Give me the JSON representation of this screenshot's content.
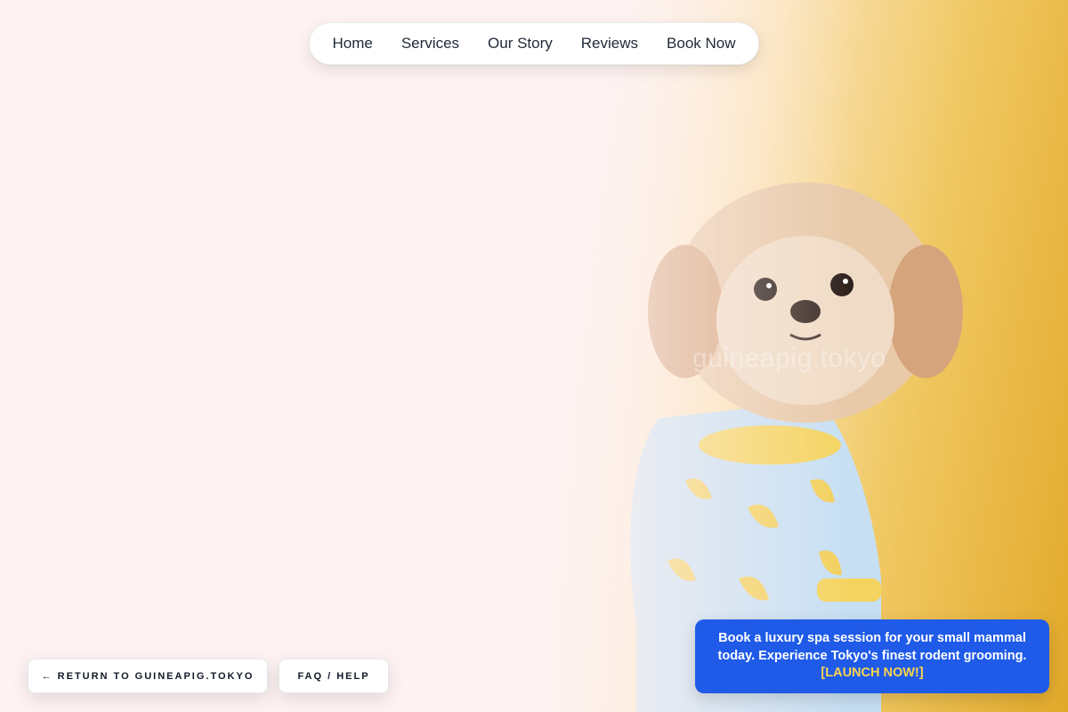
{
  "nav": {
    "items": [
      "Home",
      "Services",
      "Our Story",
      "Reviews",
      "Book Now"
    ]
  },
  "hero": {
    "watermark": "guineapig.tokyo",
    "image_alt": "Small fluffy dog wearing blue banana-print pajamas",
    "colors": {
      "accent": "#e2a92a",
      "background": "#fef3f2"
    }
  },
  "buttons": {
    "return_label": "← RETURN TO GUINEAPIG.TOKYO",
    "faq_label": "FAQ / HELP"
  },
  "promo": {
    "text": "Book a luxury spa session for your small mammal today. Experience Tokyo's finest rodent grooming.",
    "cta": "[LAUNCH NOW!]",
    "color": "#1f5be8"
  }
}
